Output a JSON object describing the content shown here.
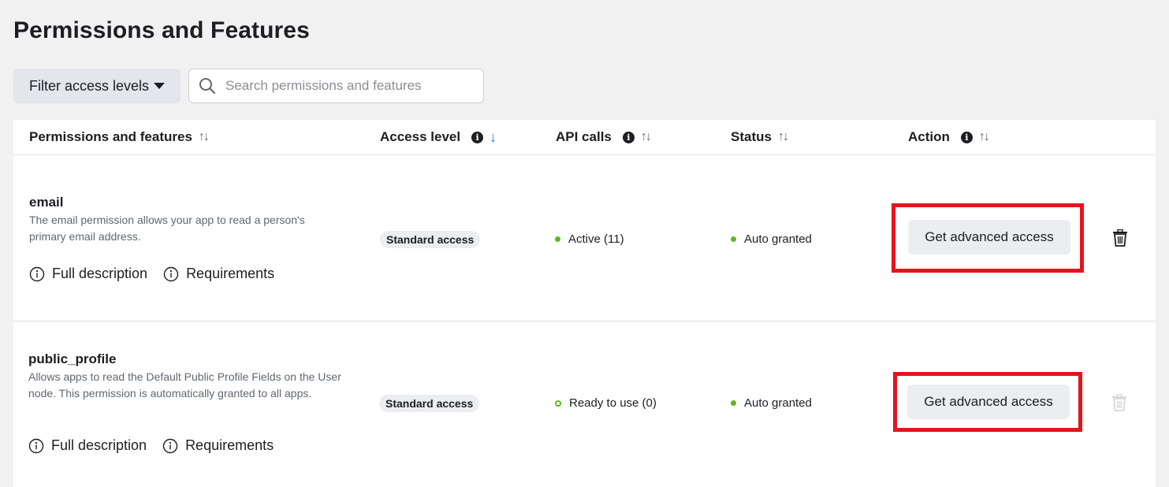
{
  "page": {
    "title": "Permissions and Features"
  },
  "toolbar": {
    "filter_label": "Filter access levels",
    "search_placeholder": "Search permissions and features"
  },
  "table": {
    "columns": [
      {
        "label": "Permissions and features",
        "sort": "unsorted",
        "info": false
      },
      {
        "label": "Access level",
        "sort": "descending",
        "info": true
      },
      {
        "label": "API calls",
        "sort": "unsorted",
        "info": true
      },
      {
        "label": "Status",
        "sort": "unsorted",
        "info": false
      },
      {
        "label": "Action",
        "sort": "unsorted",
        "info": true
      }
    ],
    "rows": [
      {
        "name": "email",
        "description": "The email permission allows your app to read a person's primary email address.",
        "full_description_label": "Full description",
        "requirements_label": "Requirements",
        "access_level": "Standard access",
        "api_calls": "Active (11)",
        "api_status_indicator": "filled",
        "status": "Auto granted",
        "action_label": "Get advanced access",
        "delete_enabled": true
      },
      {
        "name": "public_profile",
        "description": "Allows apps to read the Default Public Profile Fields on the User node. This permission is automatically granted to all apps.",
        "full_description_label": "Full description",
        "requirements_label": "Requirements",
        "access_level": "Standard access",
        "api_calls": "Ready to use (0)",
        "api_status_indicator": "hollow",
        "status": "Auto granted",
        "action_label": "Get advanced access",
        "delete_enabled": false
      }
    ]
  },
  "colors": {
    "background": "#f1f1f1",
    "status_green": "#5bb91e",
    "sort_active": "#1877f2",
    "highlight_red": "#e5141b"
  }
}
